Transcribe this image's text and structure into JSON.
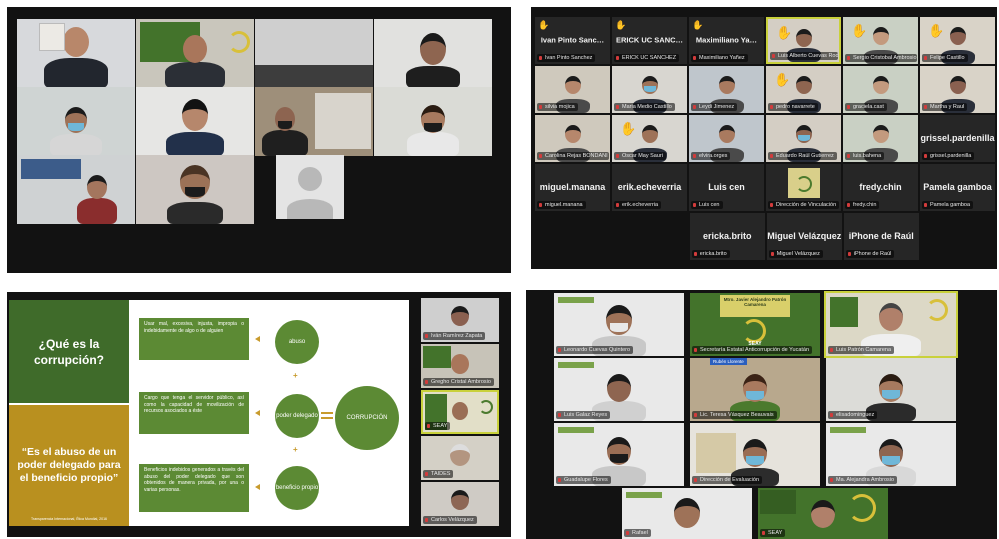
{
  "panel_top_right": {
    "raised_names": [
      "Ivan Pinto Sanc…",
      "ERICK UC SANC…",
      "Maximiliano Ya…"
    ],
    "tiles": [
      {
        "tag": "Ivan Pinto Sanchez"
      },
      {
        "tag": "ERICK UC SANCHEZ"
      },
      {
        "tag": "Maximiliano Yañez"
      },
      {
        "tag": "Luis Alberto Cuevas Rodriguez"
      },
      {
        "tag": "Sergio Cristobal Ambrosio"
      },
      {
        "tag": "Felipe Castillo"
      },
      {
        "tag": "silvia mojica"
      },
      {
        "tag": "Maria Medio Castillo"
      },
      {
        "tag": "Leydi Jimenez"
      },
      {
        "tag": "pedro navarrete"
      },
      {
        "tag": "graciela.cast"
      },
      {
        "tag": "Martha y Raul"
      },
      {
        "tag": "Carolina Rejas BONDANI"
      },
      {
        "tag": "Oscar May Sauri"
      },
      {
        "tag": "elvira.orges"
      },
      {
        "tag": "Eduardo Raúl Gutierrez"
      },
      {
        "tag": "luis.bahena"
      },
      {
        "tag": "grissel.pardenilla"
      },
      {
        "tag": "miguel.manana"
      },
      {
        "tag": "erik.echeverria"
      },
      {
        "tag": "Luis cen"
      },
      {
        "tag": "Dirección de Vinculación"
      },
      {
        "tag": "fredy.chin"
      },
      {
        "tag": "Pamela gamboa"
      },
      {
        "tag": "ericka.brito"
      },
      {
        "tag": "Miguel Velázquez"
      },
      {
        "tag": "iPhone de Raúl"
      }
    ],
    "big_names": {
      "grissel": "grissel.pardenilla",
      "miguel_manana": "miguel.manana",
      "erik": "erik.echeverria",
      "luis": "Luis cen",
      "fredy": "fredy.chin",
      "pamela": "Pamela gamboa",
      "ericka": "ericka.brito",
      "miguel_v": "Miguel Velázquez",
      "iphone": "iPhone de Raúl"
    }
  },
  "slide": {
    "question": "¿Qué es la corrupción?",
    "answer": "“Es el abuso de un poder delegado para el beneficio propio”",
    "answer_source": "Transparencia Internacional, Ética Mundial, 2016",
    "box1": "Usar mal, excesiva, injusta, impropia o indebidamente de algo o de alguien",
    "box2": "Cargo que tenga el servidor público, así como la capacidad de movilización de recursos asociados a éste",
    "box3": "Beneficios indebidos generados a través del abuso del poder delegado que son obtenidos de manera privada, por una o varias personas.",
    "circle1": "abuso",
    "circle2": "poder delegado",
    "circle3": "beneficio propio",
    "circle_main": "CORRUPCIÓN"
  },
  "panel_bottom_left_side": {
    "tags": [
      "Iván Ramírez Zapata",
      "Gregho Cristal Ambrosio",
      "SEAY",
      "TAIDES",
      "Carlos Velázquez"
    ]
  },
  "panel_bottom_right": {
    "seay_title": "Mtro. Javier Alejandro Patrón Camarena",
    "seay_label": "SEAY",
    "seay_tag": "Secretaría Estatal Anticorrupción de Yucatán",
    "tags": [
      "Leonardo Cuevas Quintero",
      "Secretaría Estatal Anticorrupción de Yucatán",
      "Luis Patrón Camarena",
      "Luis Galaz Reyes",
      "Lic. Teresa Vásquez Beauvais",
      "elisadominguez",
      "Guadalupe Flores",
      "Dirección de Evaluación",
      "Ma. Alejandra Ambrosio",
      "Rafael",
      "SEAY"
    ],
    "join_label": "Rubén Llorente"
  },
  "colors": {
    "panel_bg": "#121212",
    "slide_green": "#5c8a34",
    "slide_dark_green": "#3f6b2a",
    "slide_gold": "#b9901f",
    "arrow_gold": "#c89b2d"
  }
}
